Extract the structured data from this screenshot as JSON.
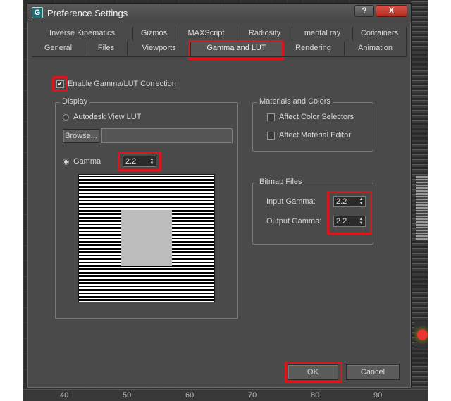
{
  "window": {
    "title": "Preference Settings",
    "help_label": "?",
    "close_label": "X"
  },
  "tabs_top": [
    {
      "label": "Inverse Kinematics"
    },
    {
      "label": "Gizmos"
    },
    {
      "label": "MAXScript"
    },
    {
      "label": "Radiosity"
    },
    {
      "label": "mental ray"
    },
    {
      "label": "Containers"
    }
  ],
  "tabs_bottom": [
    {
      "label": "General"
    },
    {
      "label": "Files"
    },
    {
      "label": "Viewports"
    },
    {
      "label": "Gamma and LUT",
      "active": true
    },
    {
      "label": "Rendering"
    },
    {
      "label": "Animation"
    }
  ],
  "enable": {
    "label": "Enable Gamma/LUT Correction",
    "checked": true,
    "check_glyph": "✔"
  },
  "display": {
    "title": "Display",
    "lut_label": "Autodesk View LUT",
    "browse_label": "Browse...",
    "browse_path": "",
    "gamma_label": "Gamma",
    "gamma_value": "2.2",
    "selected": "gamma"
  },
  "materials": {
    "title": "Materials and Colors",
    "affect_color_label": "Affect Color Selectors",
    "affect_color_checked": false,
    "affect_material_label": "Affect Material Editor",
    "affect_material_checked": false
  },
  "bitmap": {
    "title": "Bitmap Files",
    "input_label": "Input Gamma:",
    "input_value": "2.2",
    "output_label": "Output Gamma:",
    "output_value": "2.2"
  },
  "footer": {
    "ok_label": "OK",
    "cancel_label": "Cancel"
  },
  "ruler": [
    "40",
    "50",
    "60",
    "70",
    "80",
    "90"
  ],
  "icons": {
    "app": "3ds-max-icon",
    "spinner_up": "▲",
    "spinner_down": "▼",
    "app_glyph": "G"
  },
  "colors": {
    "highlight": "#d8161b",
    "dialog_bg": "#4a4a4a",
    "close": "#c03a2e"
  }
}
